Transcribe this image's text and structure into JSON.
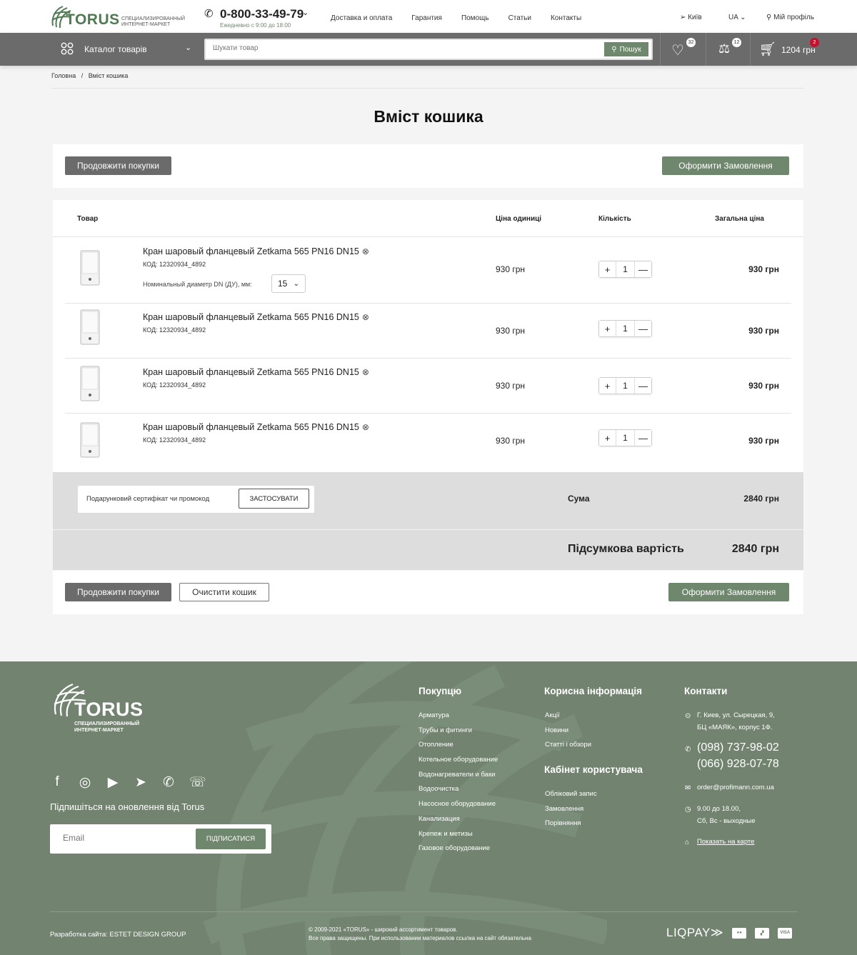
{
  "header": {
    "logo_word": "TORUS",
    "logo_tagline": "СПЕЦИАЛИЗИРОВАННЫЙ ИНТЕРНЕТ-МАРКЕТ",
    "phone": "0-800-33-49-79",
    "hours": "Ежедневно с 9:00 до 18:00",
    "nav": [
      "Доставка и оплата",
      "Гарантия",
      "Помощь",
      "Статьи",
      "Контакты"
    ],
    "city": "Київ",
    "lang": "UA",
    "profile": "Мій профіль"
  },
  "navbar": {
    "catalog": "Каталог товарів",
    "search_placeholder": "Шукати товар",
    "search_button": "Пошук",
    "wishlist_count": "32",
    "compare_count": "12",
    "cart_count": "2",
    "cart_total": "1204 грн"
  },
  "breadcrumb": [
    "Головна",
    "/",
    "Вміст кошика"
  ],
  "page_title": "Вміст кошика",
  "actions": {
    "continue": "Продовжити покупки",
    "checkout": "Оформити Замовлення",
    "clear": "Очистити кошик"
  },
  "table": {
    "headers": [
      "Товар",
      "Ціна одиниці",
      "Кількість",
      "Загальна ціна"
    ],
    "rows": [
      {
        "name": "Кран шаровый фланцевый Zetkama 565 PN16 DN15",
        "code": "КОД: 12320934_4892",
        "price": "930 грн",
        "qty": "1",
        "total": "930 грн",
        "option_label": "Номинальный диаметр DN (ДУ), мм:",
        "option_value": "15"
      },
      {
        "name": "Кран шаровый фланцевый Zetkama 565 PN16 DN15",
        "code": "КОД: 12320934_4892",
        "price": "930 грн",
        "qty": "1",
        "total": "930 грн"
      },
      {
        "name": "Кран шаровый фланцевый Zetkama 565 PN16 DN15",
        "code": "КОД: 12320934_4892",
        "price": "930 грн",
        "qty": "1",
        "total": "930 грн"
      },
      {
        "name": "Кран шаровый фланцевый Zetkama 565 PN16 DN15",
        "code": "КОД: 12320934_4892",
        "price": "930 грн",
        "qty": "1",
        "total": "930 грн"
      }
    ]
  },
  "promo": {
    "label": "Подарунковий сертифікат чи промокод",
    "apply": "ЗАСТОСУВАТИ"
  },
  "summary": {
    "sum_label": "Сума",
    "sum_value": "2840 грн",
    "final_label": "Підсумкова вартість",
    "final_value": "2840 грн"
  },
  "footer": {
    "logo_word": "TORUS",
    "logo_tagline": "СПЕЦИАЛИЗИРОВАННЫЙ ИНТЕРНЕТ-МАРКЕТ",
    "subscribe_title": "Підпишіться на оновлення від Torus",
    "subscribe_placeholder": "Email",
    "subscribe_button": "ПІДПИСАТИСЯ",
    "col1_title": "Покупцю",
    "col1": [
      "Арматура",
      "Трубы и фитинги",
      "Отопление",
      "Котельное оборудование",
      "Водонагреватели и баки",
      "Водоочистка",
      "Насосное оборудование",
      "Канализация",
      "Крепеж и метизы",
      "Газовое оборудование"
    ],
    "col2_title": "Корисна інформація",
    "col2": [
      "Акції",
      "Новини",
      "Статті і обзори"
    ],
    "col3_title": "Кабінет користувача",
    "col3": [
      "Обліковий запис",
      "Замовлення",
      "Порівняння"
    ],
    "contacts_title": "Контакти",
    "address_1": "Г. Киев, ул. Сырецкая, 9,",
    "address_2": "БЦ «МАЯК», корпус 1Ф.",
    "phone_1": "(098) 737-98-02",
    "phone_2": "(066) 928-07-78",
    "email": "order@profimann.com.ua",
    "hours_1": "9.00 до 18.00,",
    "hours_2": "Сб, Вс - выходные",
    "map_link": "Показать на карте",
    "developer": "Разработка сайта: ESTET DESIGN GROUP",
    "copyright_1": "© 2009-2021 «TORUS» - широкий ассортимент товаров.",
    "copyright_2": "Все права защищены. При использовании материалов ссылка на сайт обязательна",
    "payment_logo": "LIQPAY"
  },
  "colors": {
    "brand_green": "#6f876c",
    "navbar_grey": "#6b6b6b",
    "footer_green": "#728470",
    "badge_red": "#c8102e"
  }
}
